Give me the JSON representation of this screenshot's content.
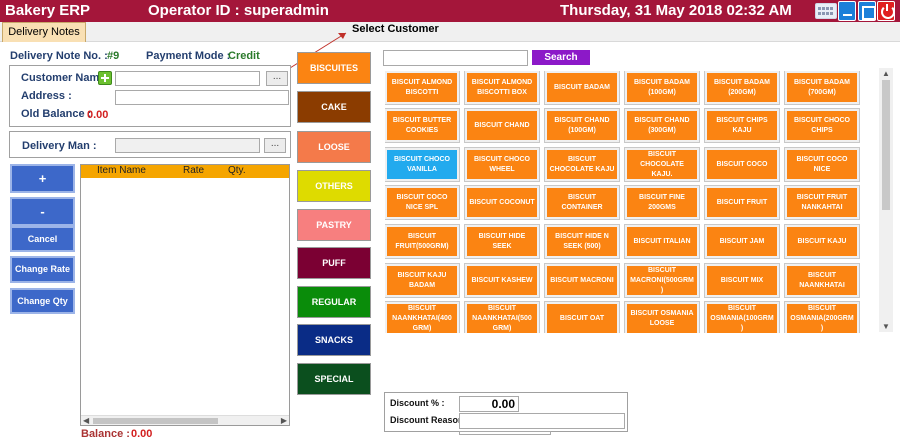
{
  "header": {
    "app_title": "Bakery ERP",
    "operator_label": "Operator ID : ",
    "operator": "superadmin",
    "datetime": "Thursday, 31 May 2018 02:32 AM",
    "colors": {
      "titlebar": "#a4163a"
    }
  },
  "tabs": [
    {
      "label": "Delivery Notes"
    }
  ],
  "annotation": {
    "select_customer": "Select Customer"
  },
  "delivery": {
    "note_no_label": "Delivery Note No. :",
    "note_no": "#9",
    "payment_mode_label": "Payment Mode :",
    "payment_mode": "Credit",
    "customer_name_label": "Customer Name",
    "address_label": "Address :",
    "old_balance_label": "Old Balance :",
    "old_balance": "0.00",
    "delivery_man_label": "Delivery Man :",
    "browse_label": "...",
    "balance_label": "Balance :",
    "balance": "0.00"
  },
  "actions": {
    "add": "+",
    "remove": "-",
    "cancel": "Cancel",
    "change_rate": "Change Rate",
    "change_qty": "Change Qty"
  },
  "grid": {
    "columns": [
      "Item Name",
      "Rate",
      "Qty."
    ]
  },
  "categories": [
    {
      "label": "BISCUITES",
      "color": "#fb8412",
      "text": "#ffffff"
    },
    {
      "label": "CAKE",
      "color": "#8b3c00",
      "text": "#ffffff"
    },
    {
      "label": "LOOSE",
      "color": "#f47a4a",
      "text": "#ffffff"
    },
    {
      "label": "OTHERS",
      "color": "#dedb00",
      "text": "#ffffff"
    },
    {
      "label": "PASTRY",
      "color": "#f77f7f",
      "text": "#ffffff"
    },
    {
      "label": "PUFF",
      "color": "#7b0033",
      "text": "#ffffff"
    },
    {
      "label": "REGULAR",
      "color": "#0a8c0a",
      "text": "#ffffff"
    },
    {
      "label": "SNACKS",
      "color": "#0a2c86",
      "text": "#ffffff"
    },
    {
      "label": "SPECIAL",
      "color": "#0b4f1e",
      "text": "#ffffff"
    }
  ],
  "search": {
    "button_label": "Search",
    "value": "",
    "button_color": "#8c19c8"
  },
  "products": [
    "BISCUIT ALMOND BISCOTTI",
    "BISCUIT ALMOND BISCOTTI BOX",
    "BISCUIT BADAM",
    "BISCUIT BADAM (100GM)",
    "BISCUIT BADAM (200GM)",
    "BISCUIT BADAM (700GM)",
    "BISCUIT BUTTER COOKIES",
    "BISCUIT CHAND",
    "BISCUIT CHAND (100GM)",
    "BISCUIT CHAND (300GM)",
    "BISCUIT CHIPS KAJU",
    "BISCUIT CHOCO CHIPS",
    "BISCUIT CHOCO VANILLA",
    "BISCUIT CHOCO WHEEL",
    "BISCUIT CHOCOLATE KAJU",
    "BISCUIT CHOCOLATE KAJU.",
    "BISCUIT COCO",
    "BISCUIT COCO NICE",
    "BISCUIT COCO NICE SPL",
    "BISCUIT COCONUT",
    "BISCUIT CONTAINER",
    "BISCUIT FINE 200GMS",
    "BISCUIT FRUIT",
    "BISCUIT FRUIT NANKAHTAI",
    "BISCUIT FRUIT(500GRM)",
    "BISCUIT HIDE SEEK",
    "BISCUIT HIDE N SEEK (500)",
    "BISCUIT ITALIAN",
    "BISCUIT JAM",
    "BISCUIT KAJU",
    "BISCUIT KAJU BADAM",
    "BISCUIT KASHEW",
    "BISCUIT MACRONI",
    "BISCUIT MACRONI(500GRM )",
    "BISCUIT MIX",
    "BISCUIT NAANKHATAI",
    "BISCUIT NAANKHATAI(400 GRM)",
    "BISCUIT NAANKHATAI(500 GRM)",
    "BISCUIT OAT",
    "BISCUIT OSMANIA LOOSE",
    "BISCUIT OSMANIA(100GRM )",
    "BISCUIT OSMANIA(200GRM )"
  ],
  "selected_product": "BISCUIT CHOCO VANILLA",
  "product_colors": {
    "normal": "#fb8412",
    "selected": "#22aaee"
  },
  "discount": {
    "percent_label": "Discount % :",
    "percent_value": "0.00",
    "reason_label": "Discount Reason"
  }
}
